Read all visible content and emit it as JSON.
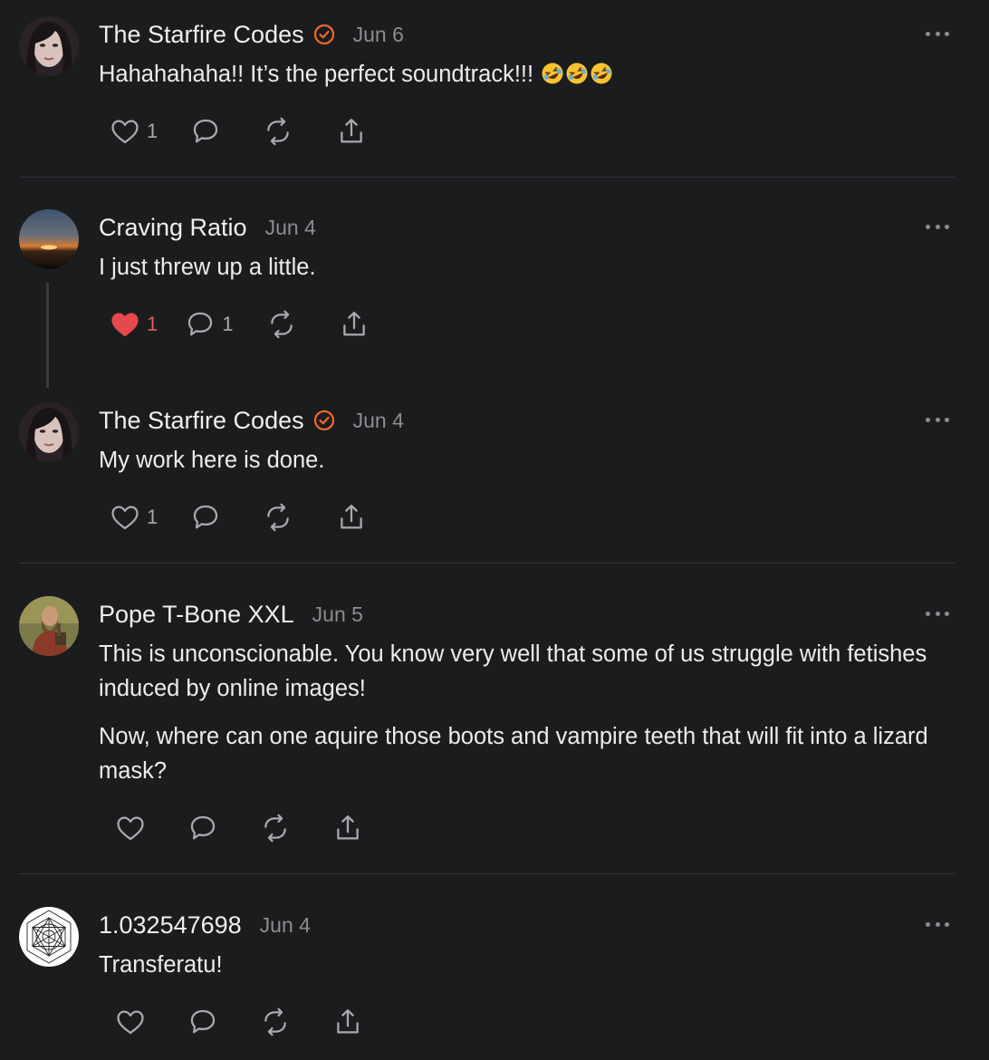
{
  "comments": [
    {
      "author": "The Starfire Codes",
      "verified": true,
      "date": "Jun 6",
      "paragraphs": [
        "Hahahahaha!! It’s the perfect soundtrack!!!"
      ],
      "emoji": "🤣🤣🤣",
      "likes": "1",
      "liked": false,
      "replies": "",
      "avatar": "woman-portrait"
    },
    {
      "author": "Craving Ratio",
      "verified": false,
      "date": "Jun 4",
      "paragraphs": [
        "I just threw up a little."
      ],
      "likes": "1",
      "liked": true,
      "replies": "1",
      "avatar": "sunset-landscape"
    },
    {
      "author": "The Starfire Codes",
      "verified": true,
      "date": "Jun 4",
      "paragraphs": [
        "My work here is done."
      ],
      "likes": "1",
      "liked": false,
      "replies": "",
      "avatar": "woman-portrait"
    },
    {
      "author": "Pope T-Bone XXL",
      "verified": false,
      "date": "Jun 5",
      "paragraphs": [
        "This is unconscionable. You know very well that some of us struggle with fetishes induced by online images!",
        "Now, where can one aquire those boots and vampire teeth that will fit into a lizard mask?"
      ],
      "likes": "",
      "liked": false,
      "replies": "",
      "avatar": "bearded-man"
    },
    {
      "author": "1.032547698",
      "verified": false,
      "date": "Jun 4",
      "paragraphs": [
        "Transferatu!"
      ],
      "likes": "",
      "liked": false,
      "replies": "",
      "avatar": "geometric-metatron-cube"
    }
  ],
  "colors": {
    "background": "#1b1c1e",
    "verified_badge": "#f06a2a",
    "liked_heart": "#e5484d",
    "muted": "#8c8d90"
  },
  "icons": [
    "heart-icon",
    "comment-icon",
    "restack-icon",
    "share-icon",
    "more-options-icon",
    "verified-badge-icon"
  ]
}
